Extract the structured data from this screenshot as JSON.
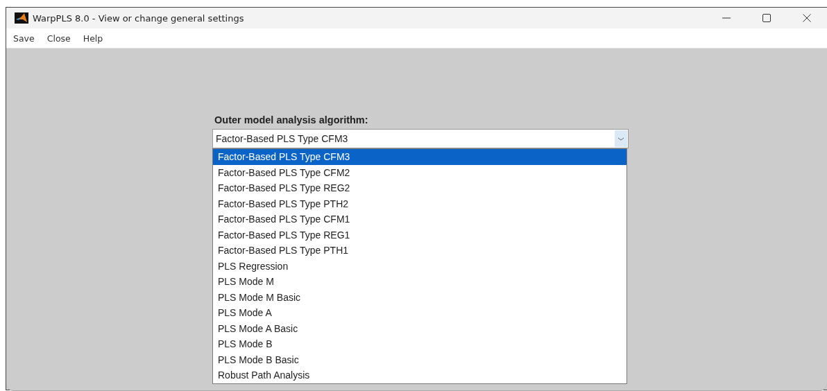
{
  "window": {
    "title": "WarpPLS 8.0 - View or change general settings"
  },
  "menu": [
    "Save",
    "Close",
    "Help"
  ],
  "field": {
    "label": "Outer model analysis algorithm:",
    "value": "Factor-Based PLS Type CFM3",
    "expanded": true
  },
  "options": [
    {
      "label": "Factor-Based PLS Type CFM3",
      "selected": true
    },
    {
      "label": "Factor-Based PLS Type CFM2",
      "selected": false
    },
    {
      "label": "Factor-Based PLS Type REG2",
      "selected": false
    },
    {
      "label": "Factor-Based PLS Type PTH2",
      "selected": false
    },
    {
      "label": "Factor-Based PLS Type CFM1",
      "selected": false
    },
    {
      "label": "Factor-Based PLS Type REG1",
      "selected": false
    },
    {
      "label": "Factor-Based PLS Type PTH1",
      "selected": false
    },
    {
      "label": "PLS Regression",
      "selected": false
    },
    {
      "label": "PLS Mode M",
      "selected": false
    },
    {
      "label": "PLS Mode M Basic",
      "selected": false
    },
    {
      "label": "PLS Mode A",
      "selected": false
    },
    {
      "label": "PLS Mode A Basic",
      "selected": false
    },
    {
      "label": "PLS Mode B",
      "selected": false
    },
    {
      "label": "PLS Mode B Basic",
      "selected": false
    },
    {
      "label": "Robust Path Analysis",
      "selected": false
    }
  ]
}
